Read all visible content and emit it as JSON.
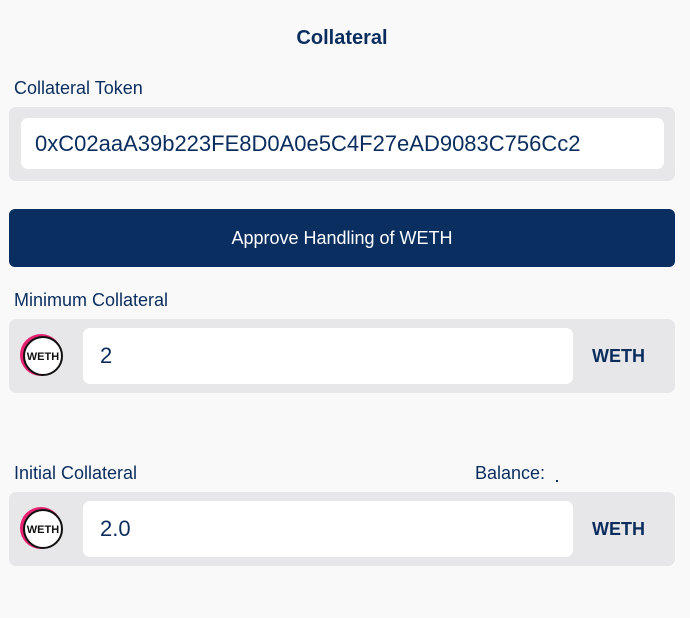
{
  "title": "Collateral",
  "collateral_token": {
    "label": "Collateral Token",
    "value": "0xC02aaA39b223FE8D0A0e5C4F27eAD9083C756Cc2"
  },
  "approve_button": {
    "label": "Approve Handling of WETH"
  },
  "minimum_collateral": {
    "label": "Minimum Collateral",
    "value": "2",
    "token_icon": "weth-logo-icon",
    "token_symbol": "WETH",
    "icon_text": "WETH"
  },
  "initial_collateral": {
    "label": "Initial Collateral",
    "balance_label": "Balance:",
    "value": "2.0",
    "token_icon": "weth-logo-icon",
    "token_symbol": "WETH",
    "icon_text": "WETH"
  },
  "colors": {
    "primary": "#0b2e61",
    "panel": "#e7e7e9",
    "background": "#f9f9fa",
    "weth_pink": "#e6216f"
  }
}
